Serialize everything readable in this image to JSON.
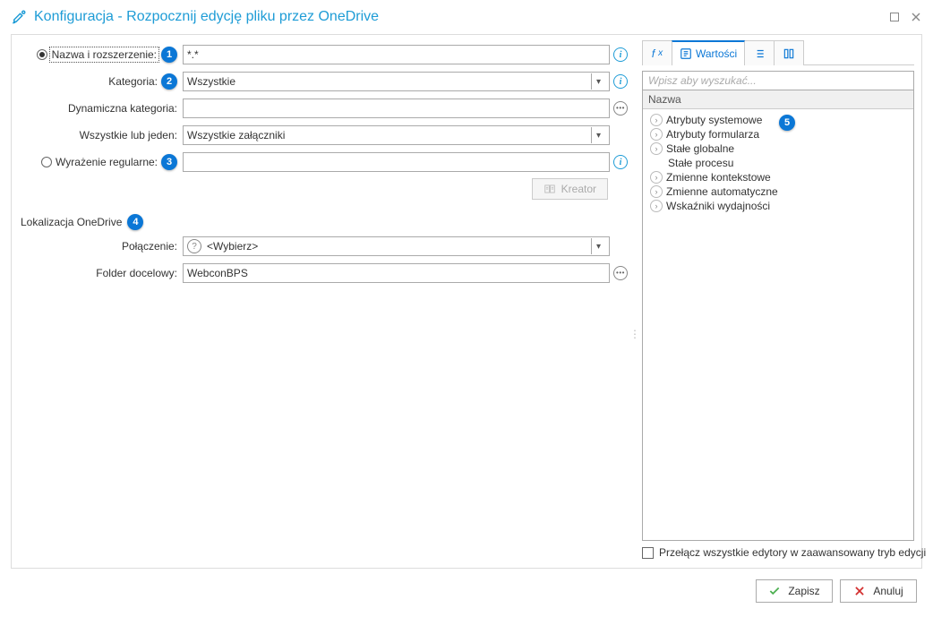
{
  "window": {
    "title": "Konfiguracja - Rozpocznij edycję pliku przez OneDrive"
  },
  "form": {
    "name_ext_label": "Nazwa i rozszerzenie:",
    "name_ext_value": "*.*",
    "kategoria_label": "Kategoria:",
    "kategoria_value": "Wszystkie",
    "dyn_kat_label": "Dynamiczna kategoria:",
    "wszystkie_lub_label": "Wszystkie lub jeden:",
    "wszystkie_lub_value": "Wszystkie załączniki",
    "regex_label": "Wyrażenie regularne:",
    "kreator_label": "Kreator",
    "onedrive_section": "Lokalizacja OneDrive",
    "polaczenie_label": "Połączenie:",
    "polaczenie_value": "<Wybierz>",
    "folder_label": "Folder docelowy:",
    "folder_value": "WebconBPS"
  },
  "right": {
    "tab_wartosci": "Wartości",
    "search_placeholder": "Wpisz aby wyszukać...",
    "tree_header": "Nazwa",
    "items": [
      "Atrybuty systemowe",
      "Atrybuty formularza",
      "Stałe globalne",
      "Stałe procesu",
      "Zmienne kontekstowe",
      "Zmienne automatyczne",
      "Wskaźniki wydajności"
    ],
    "adv_label": "Przełącz wszystkie edytory w zaawansowany tryb edycji"
  },
  "footer": {
    "save": "Zapisz",
    "cancel": "Anuluj"
  },
  "callouts": {
    "c1": "1",
    "c2": "2",
    "c3": "3",
    "c4": "4",
    "c5": "5"
  }
}
